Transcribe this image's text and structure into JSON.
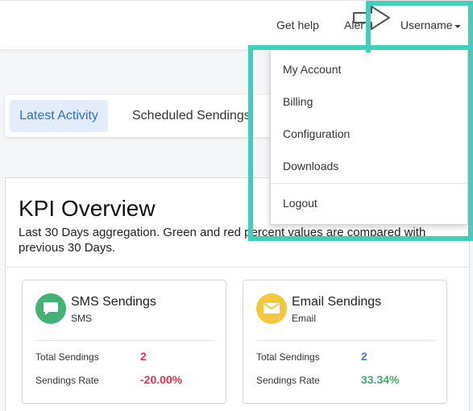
{
  "header": {
    "help_label": "Get help",
    "alerts_label": "Aler",
    "user_label": "Username"
  },
  "tabs": {
    "active": "Latest Activity",
    "second": "Scheduled Sendings"
  },
  "kpi": {
    "title": "KPI Overview",
    "description": "Last 30 Days aggregation. Green and red percent values are compared with previous 30 Days."
  },
  "cards": [
    {
      "title": "SMS Sendings",
      "subtitle": "SMS",
      "icon": "chat-bubble-icon",
      "icon_color": "#43b276",
      "rows": [
        {
          "label": "Total Sendings",
          "value": "2",
          "color": "#e0344d"
        },
        {
          "label": "Sendings Rate",
          "value": "-20.00%",
          "color": "#e0344d"
        }
      ]
    },
    {
      "title": "Email Sendings",
      "subtitle": "Email",
      "icon": "envelope-icon",
      "icon_color": "#f6c63d",
      "rows": [
        {
          "label": "Total Sendings",
          "value": "2",
          "color": "#3f7fd6"
        },
        {
          "label": "Sendings Rate",
          "value": "33.34%",
          "color": "#3fab6f"
        }
      ]
    }
  ],
  "menu": {
    "items": [
      "My Account",
      "Billing",
      "Configuration",
      "Downloads"
    ],
    "logout": "Logout"
  },
  "highlight_color": "#3fcfbb"
}
